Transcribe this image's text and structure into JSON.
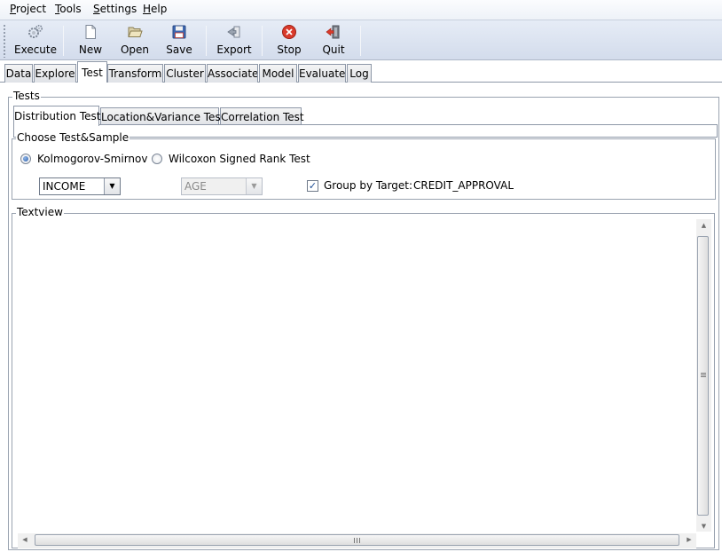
{
  "menu": {
    "items": [
      {
        "mnemonic": "P",
        "rest": "roject"
      },
      {
        "mnemonic": "T",
        "rest": "ools"
      },
      {
        "mnemonic": "S",
        "rest": "ettings"
      },
      {
        "mnemonic": "H",
        "rest": "elp"
      }
    ]
  },
  "toolbar": {
    "execute": {
      "label": "Execute",
      "icon": "gears-icon"
    },
    "new": {
      "label": "New",
      "icon": "new-document-icon"
    },
    "open": {
      "label": "Open",
      "icon": "folder-open-icon"
    },
    "save": {
      "label": "Save",
      "icon": "floppy-disk-icon"
    },
    "export": {
      "label": "Export",
      "icon": "export-icon"
    },
    "stop": {
      "label": "Stop",
      "icon": "stop-icon"
    },
    "quit": {
      "label": "Quit",
      "icon": "quit-door-icon"
    }
  },
  "main_tabs": [
    "Data",
    "Explore",
    "Test",
    "Transform",
    "Cluster",
    "Associate",
    "Model",
    "Evaluate",
    "Log"
  ],
  "active_main_tab": "Test",
  "tests_group": {
    "title": "Tests",
    "subtabs": [
      "Distribution Test",
      "Location&Variance Test",
      "Correlation Test"
    ],
    "active_subtab": "Distribution Test"
  },
  "choose_group": {
    "title": "Choose Test&Sample",
    "radio_ks": {
      "label": "Kolmogorov-Smirnov",
      "selected": true
    },
    "radio_wilcoxon": {
      "label": "Wilcoxon Signed Rank Test",
      "selected": false
    },
    "variable_combo": {
      "value": "INCOME"
    },
    "second_combo": {
      "value": "AGE",
      "enabled": false
    },
    "group_by": {
      "label": "Group by Target:",
      "checked": true,
      "target": "CREDIT_APPROVAL"
    }
  },
  "textview": {
    "title": "Textview",
    "content": ""
  },
  "colors": {
    "accent": "#2d5fa8",
    "toolbar_bg": "#dfe5f1",
    "stop_red": "#d93a2b"
  }
}
